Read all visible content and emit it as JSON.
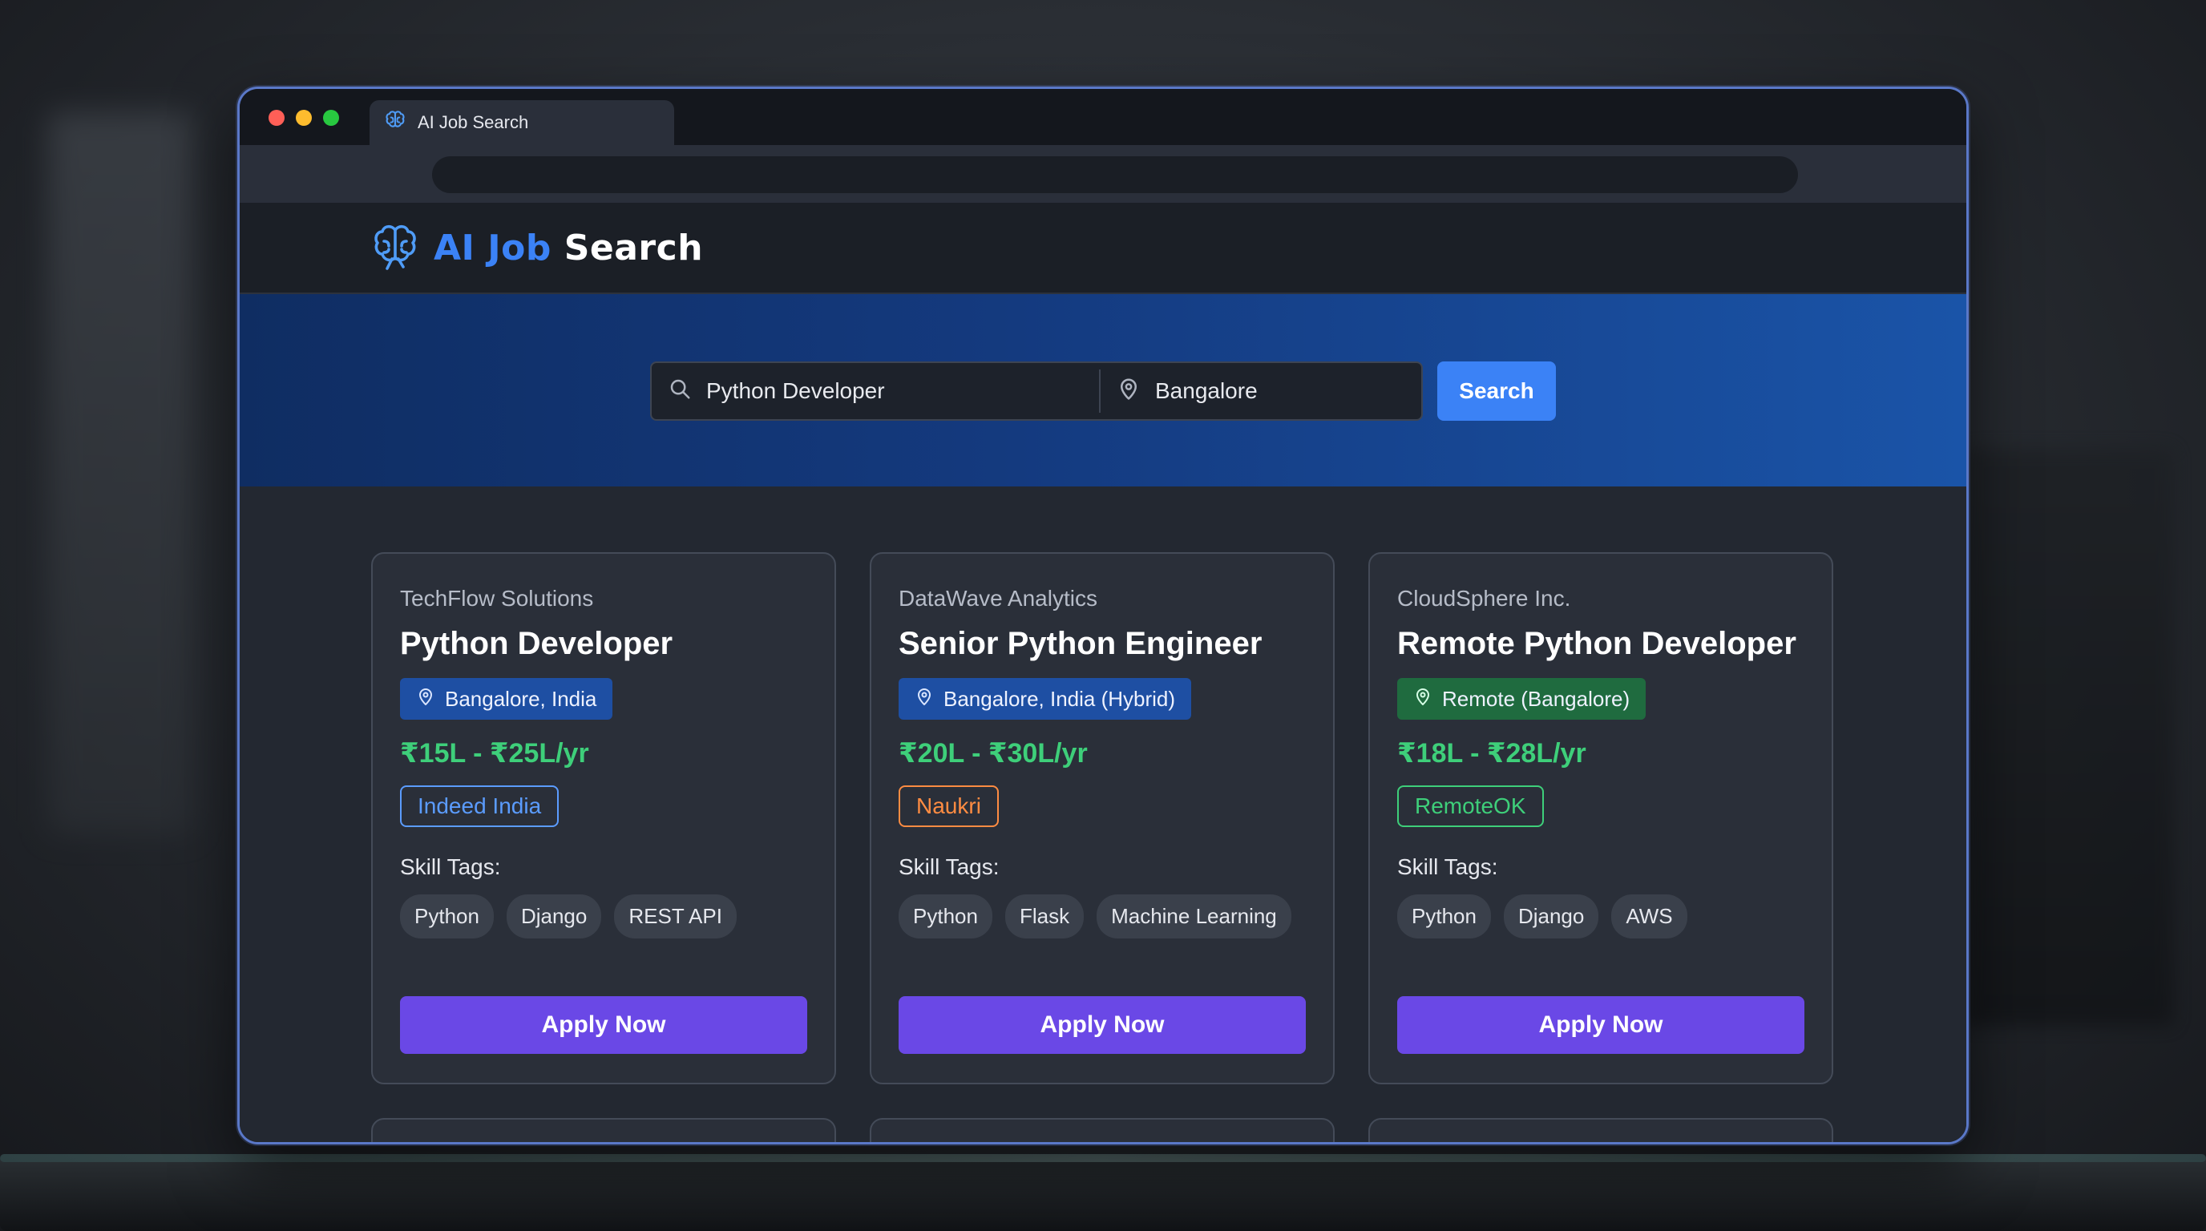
{
  "browser": {
    "tab_title": "AI Job Search",
    "tab_icon": "brain-icon"
  },
  "header": {
    "brand_ai": "AI",
    "brand_job": "Job",
    "brand_search": "Search",
    "logo_icon": "brain-icon"
  },
  "search": {
    "query_value": "Python Developer",
    "location_value": "Bangalore",
    "button_label": "Search"
  },
  "jobs": [
    {
      "company": "TechFlow Solutions",
      "title": "Python Developer",
      "location": "Bangalore, India",
      "location_style": "blue",
      "salary": "₹15L - ₹25L/yr",
      "source": "Indeed India",
      "skill_label": "Skill Tags:",
      "skills": [
        "Python",
        "Django",
        "REST API"
      ],
      "apply_label": "Apply Now"
    },
    {
      "company": "DataWave Analytics",
      "title": "Senior Python Engineer",
      "location": "Bangalore, India (Hybrid)",
      "location_style": "blue",
      "salary": "₹20L - ₹30L/yr",
      "source": "Naukri",
      "skill_label": "Skill Tags:",
      "skills": [
        "Python",
        "Flask",
        "Machine Learning"
      ],
      "apply_label": "Apply Now"
    },
    {
      "company": "CloudSphere Inc.",
      "title": "Remote Python Developer",
      "location": "Remote (Bangalore)",
      "location_style": "green",
      "salary": "₹18L - ₹28L/yr",
      "source": "RemoteOK",
      "skill_label": "Skill Tags:",
      "skills": [
        "Python",
        "Django",
        "AWS"
      ],
      "apply_label": "Apply Now"
    }
  ],
  "colors": {
    "accent": "#3b82f6",
    "apply_button": "#6a48e6",
    "salary": "#3ecf7a",
    "indeed": "#5b9cff",
    "naukri": "#ff8c42",
    "remoteok": "#3ecf7a"
  }
}
